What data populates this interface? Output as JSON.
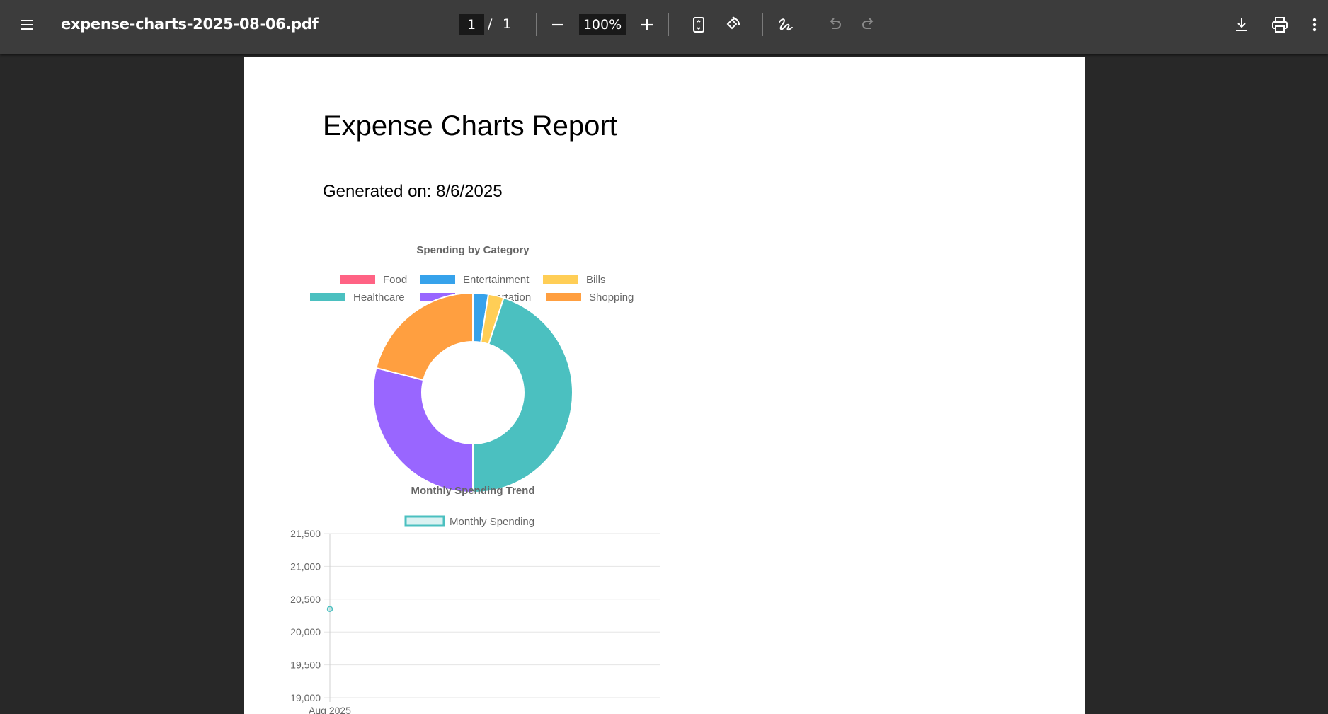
{
  "toolbar": {
    "filename": "expense-charts-2025-08-06.pdf",
    "current_page": "1",
    "page_separator": "/",
    "total_pages": "1",
    "zoom": "100%",
    "icons": [
      "menu-icon",
      "zoom-out-icon",
      "zoom-in-icon",
      "fit-page-icon",
      "rotate-icon",
      "draw-icon",
      "undo-icon",
      "redo-icon",
      "download-icon",
      "print-icon",
      "more-vert-icon"
    ]
  },
  "document": {
    "title": "Expense Charts Report",
    "generated": "Generated on: 8/6/2025"
  },
  "chart_data": [
    {
      "type": "doughnut",
      "title": "Spending by Category",
      "legend_position": "top",
      "categories": [
        "Food",
        "Entertainment",
        "Bills",
        "Healthcare",
        "Transportation",
        "Shopping"
      ],
      "colors": [
        "#ff6384",
        "#36a2eb",
        "#ffce56",
        "#4bc0c0",
        "#9966ff",
        "#ff9f40"
      ],
      "values": [
        0,
        2.5,
        2.5,
        45,
        29,
        21
      ],
      "unit": "percent (estimated share)"
    },
    {
      "type": "line",
      "title": "Monthly Spending Trend",
      "legend_position": "top",
      "series": [
        {
          "name": "Monthly Spending",
          "color": "#4bc0c0",
          "x": [
            "Aug 2025"
          ],
          "values": [
            20350
          ]
        }
      ],
      "xlabel": "",
      "ylabel": "",
      "ylim": [
        19000,
        21500
      ],
      "y_ticks": [
        "21,500",
        "21,000",
        "20,500",
        "20,000",
        "19,500",
        "19,000"
      ],
      "grid": true
    }
  ]
}
